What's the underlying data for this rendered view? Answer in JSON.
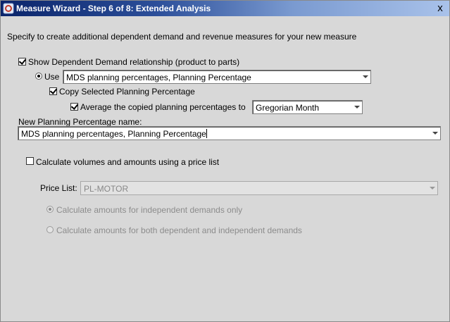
{
  "window": {
    "title": "Measure Wizard - Step 6 of 8: Extended Analysis",
    "close_glyph": "x",
    "icon": "oracle-app-icon"
  },
  "instruction": "Specify to create additional dependent demand and revenue measures for your new measure",
  "dependent_demand": {
    "label": "Show Dependent Demand relationship (product to parts)",
    "checked": true,
    "use_label": "Use",
    "use_selected": true,
    "use_value": "MDS planning percentages, Planning Percentage",
    "copy_label": "Copy Selected Planning Percentage",
    "copy_checked": true,
    "average_label": "Average the copied planning percentages to",
    "average_checked": true,
    "average_value": "Gregorian Month",
    "new_name_label": "New Planning Percentage name:",
    "new_name_value": "MDS planning percentages, Planning Percentage"
  },
  "price_list_section": {
    "label": "Calculate volumes and amounts using a price list",
    "checked": false,
    "price_list_label": "Price List:",
    "price_list_value": "PL-MOTOR",
    "radio_independent": "Calculate amounts for independent demands only",
    "radio_independent_selected": true,
    "radio_both": "Calculate amounts for both dependent and independent demands",
    "enabled": false
  }
}
